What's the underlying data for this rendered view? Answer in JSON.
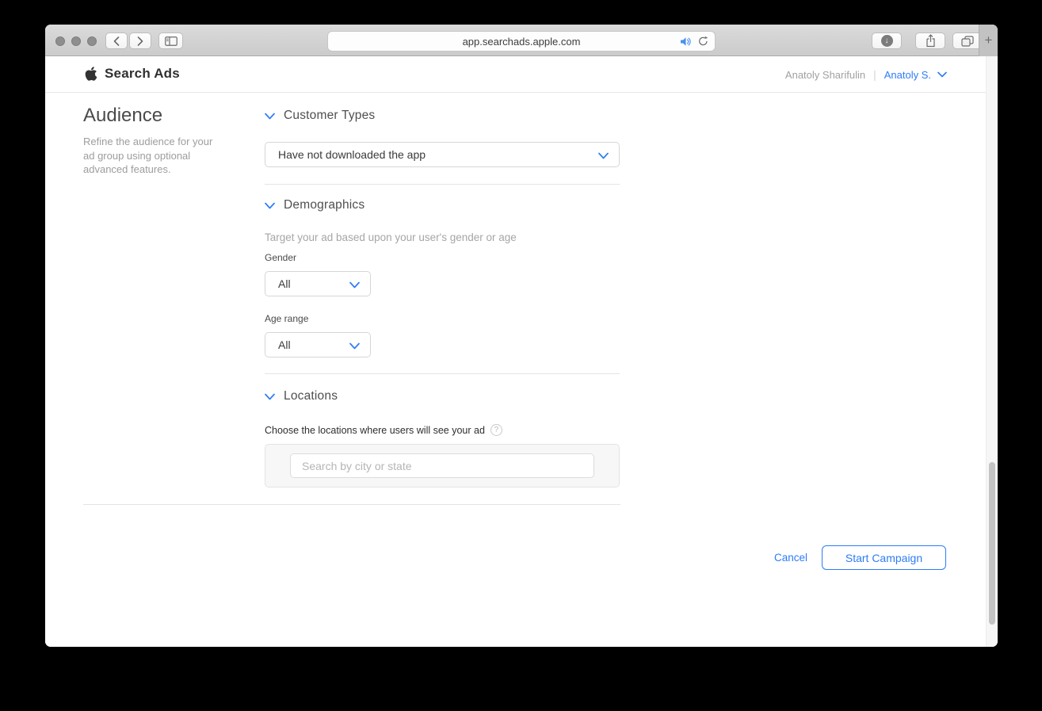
{
  "browser": {
    "url": "app.searchads.apple.com",
    "new_tab_glyph": "+",
    "download_glyph": "↓"
  },
  "header": {
    "brand": "Search Ads",
    "account_name": "Anatoly Sharifulin",
    "separator": "|",
    "user_menu": "Anatoly S."
  },
  "sidebar": {
    "title": "Audience",
    "description": "Refine the audience for your ad group using optional advanced features."
  },
  "sections": {
    "customer_types": {
      "title": "Customer Types",
      "dropdown_value": "Have not downloaded the app"
    },
    "demographics": {
      "title": "Demographics",
      "subtitle": "Target your ad based upon your user's gender or age",
      "gender_label": "Gender",
      "gender_value": "All",
      "age_label": "Age range",
      "age_value": "All"
    },
    "locations": {
      "title": "Locations",
      "prompt": "Choose the locations where users will see your ad",
      "help_glyph": "?",
      "search_placeholder": "Search by city or state"
    }
  },
  "footer": {
    "cancel_label": "Cancel",
    "start_label": "Start Campaign"
  },
  "colors": {
    "accent_blue": "#2e7cf6",
    "page_background": "#ffffff",
    "panel_background": "#f7f7f7"
  }
}
